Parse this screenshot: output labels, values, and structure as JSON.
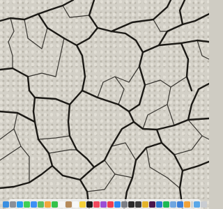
{
  "wallpaper": {
    "name": "cracked-dry-earth-wallpaper",
    "base_color": "#d3d0c7",
    "crack_color": "#1b1915"
  },
  "dock": {
    "background": "#f0f0f0",
    "apps": [
      {
        "name": "finder-icon",
        "color": "#3b8fe0"
      },
      {
        "name": "launchpad-icon",
        "color": "#8a8f98"
      },
      {
        "name": "safari-icon",
        "color": "#2a9cf0"
      },
      {
        "name": "messages-icon",
        "color": "#3fcf55"
      },
      {
        "name": "mail-icon",
        "color": "#3d8ff5"
      },
      {
        "name": "maps-icon",
        "color": "#5cbf62"
      },
      {
        "name": "photos-icon",
        "color": "#f2a63b"
      },
      {
        "name": "facetime-icon",
        "color": "#35c24a"
      },
      {
        "name": "calendar-icon",
        "color": "#f5f5f5"
      },
      {
        "name": "contacts-icon",
        "color": "#b58a5a"
      },
      {
        "name": "reminders-icon",
        "color": "#f7f7f7"
      },
      {
        "name": "notes-icon",
        "color": "#f4d03a"
      },
      {
        "name": "tv-icon",
        "color": "#1c1c1e"
      },
      {
        "name": "music-icon",
        "color": "#f0485d"
      },
      {
        "name": "podcasts-icon",
        "color": "#9b4fd6"
      },
      {
        "name": "news-icon",
        "color": "#ee3d4f"
      },
      {
        "name": "app-store-icon",
        "color": "#2d87f2"
      },
      {
        "name": "system-preferences-icon",
        "color": "#7c7f86"
      },
      {
        "name": "terminal-icon",
        "color": "#2a2a2a"
      },
      {
        "name": "activity-monitor-icon",
        "color": "#3a3a3a"
      },
      {
        "name": "chrome-icon",
        "color": "#e3b32b"
      },
      {
        "name": "slack-icon",
        "color": "#4a154b"
      },
      {
        "name": "vscode-icon",
        "color": "#2a7ad0"
      },
      {
        "name": "spotify-icon",
        "color": "#1db954"
      },
      {
        "name": "preview-icon",
        "color": "#6fa6e0"
      },
      {
        "name": "keynote-icon",
        "color": "#3b7fd8"
      },
      {
        "name": "pages-icon",
        "color": "#f0a23a"
      }
    ],
    "trailing": [
      {
        "name": "downloads-folder-icon",
        "color": "#5aa7e8"
      },
      {
        "name": "trash-icon",
        "color": "#c9ccd1"
      }
    ]
  }
}
